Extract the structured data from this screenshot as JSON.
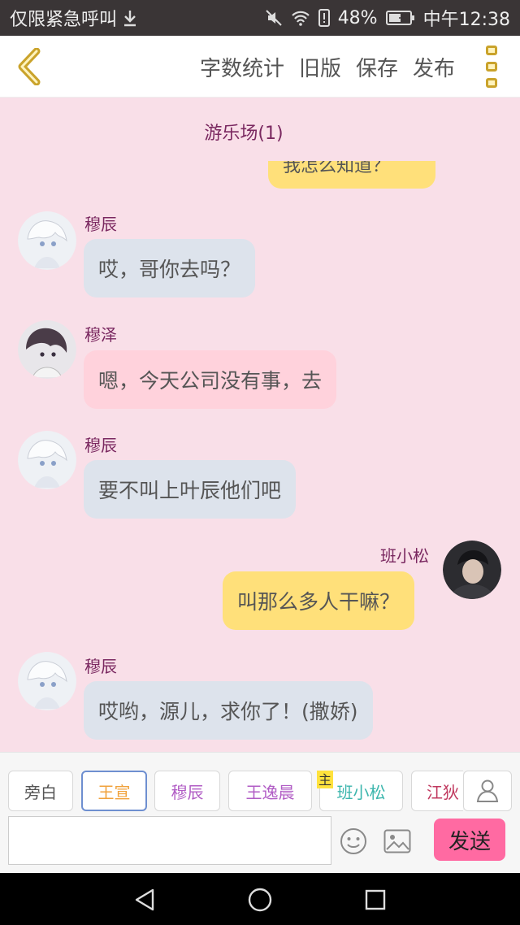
{
  "status_bar": {
    "left_text": "仅限紧急呼叫",
    "battery": "48%",
    "time": "中午12:38"
  },
  "header": {
    "actions": [
      "字数统计",
      "旧版",
      "保存",
      "发布"
    ]
  },
  "chat": {
    "title": "游乐场(1)",
    "partial_top_text": "我怎么知道？",
    "messages": [
      {
        "name": "穆辰",
        "text": "哎，哥你去吗？",
        "side": "left",
        "color": "#dde3ec"
      },
      {
        "name": "穆泽",
        "text": "嗯，今天公司没有事，去",
        "side": "left",
        "color": "#ffd2dc"
      },
      {
        "name": "穆辰",
        "text": "要不叫上叶辰他们吧",
        "side": "left",
        "color": "#dde3ec"
      },
      {
        "name": "班小松",
        "text": "叫那么多人干嘛？",
        "side": "right",
        "color": "#ffe07a"
      },
      {
        "name": "穆辰",
        "text": "哎哟，源儿，求你了！(撒娇)",
        "side": "left",
        "color": "#dde3ec"
      }
    ]
  },
  "composer": {
    "roles": [
      {
        "label": "旁白",
        "color": "#555555"
      },
      {
        "label": "王宣",
        "color": "#f0a23c"
      },
      {
        "label": "穆辰",
        "color": "#b15dc5"
      },
      {
        "label": "王逸晨",
        "color": "#b15dc5"
      },
      {
        "label": "班小松",
        "color": "#3cb6ad"
      },
      {
        "label": "江狄",
        "color": "#c0395f"
      }
    ],
    "main_badge": "主",
    "input_value": "",
    "send_label": "发送"
  }
}
